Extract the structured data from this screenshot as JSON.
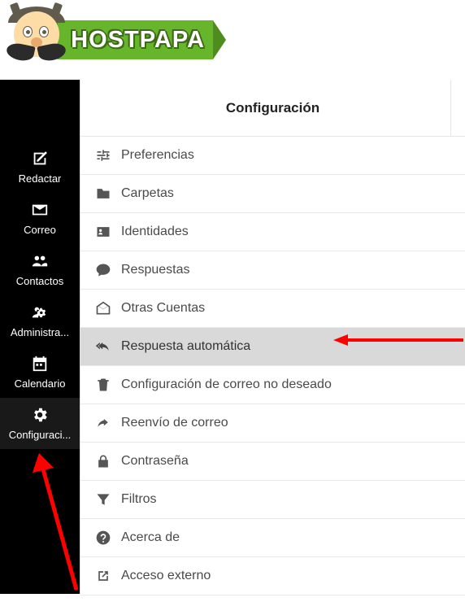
{
  "brand": {
    "name": "HOSTPAPA"
  },
  "sidebar": {
    "items": [
      {
        "label": "Redactar",
        "icon": "compose-icon"
      },
      {
        "label": "Correo",
        "icon": "mail-icon"
      },
      {
        "label": "Contactos",
        "icon": "contacts-icon"
      },
      {
        "label": "Administra...",
        "icon": "admin-icon"
      },
      {
        "label": "Calendario",
        "icon": "calendar-icon"
      },
      {
        "label": "Configuraci...",
        "icon": "gear-icon",
        "active": true
      }
    ]
  },
  "panel": {
    "title": "Configuración",
    "items": [
      {
        "label": "Preferencias",
        "icon": "sliders-icon"
      },
      {
        "label": "Carpetas",
        "icon": "folder-icon"
      },
      {
        "label": "Identidades",
        "icon": "id-card-icon"
      },
      {
        "label": "Respuestas",
        "icon": "speech-icon"
      },
      {
        "label": "Otras Cuentas",
        "icon": "envelope-open-icon"
      },
      {
        "label": "Respuesta automática",
        "icon": "reply-all-icon",
        "selected": true
      },
      {
        "label": "Configuración de correo no deseado",
        "icon": "trash-icon"
      },
      {
        "label": "Reenvío de correo",
        "icon": "forward-icon"
      },
      {
        "label": "Contraseña",
        "icon": "lock-icon"
      },
      {
        "label": "Filtros",
        "icon": "filter-icon"
      },
      {
        "label": "Acerca de",
        "icon": "help-icon"
      },
      {
        "label": "Acceso externo",
        "icon": "external-link-icon"
      }
    ]
  },
  "annotations": {
    "arrow_to_item": "Respuesta automática",
    "arrow_to_sidebar": "Configuración"
  }
}
